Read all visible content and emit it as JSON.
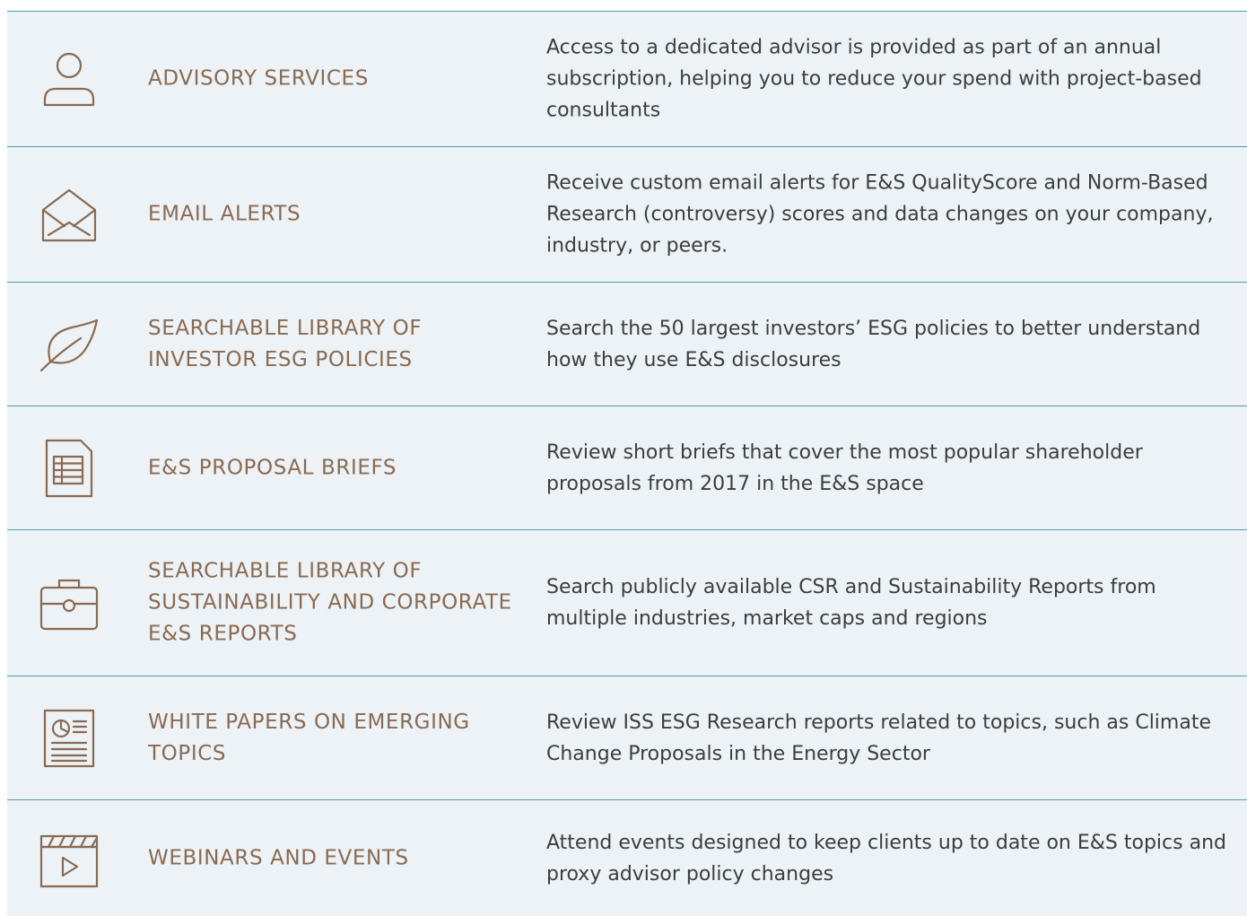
{
  "rows": [
    {
      "icon": "person-icon",
      "title": "ADVISORY SERVICES",
      "description": "Access to a dedicated advisor is provided as part of an annual subscription, helping you to reduce your spend with project-based consultants"
    },
    {
      "icon": "envelope-icon",
      "title": "EMAIL ALERTS",
      "description": "Receive custom email alerts for E&S QualityScore and Norm-Based Research (controversy) scores and data changes on your company, industry, or peers."
    },
    {
      "icon": "leaf-icon",
      "title": "SEARCHABLE LIBRARY OF INVESTOR ESG POLICIES",
      "description": "Search the 50 largest investors’ ESG policies to better understand how they use E&S disclosures"
    },
    {
      "icon": "spreadsheet-document-icon",
      "title": "E&S PROPOSAL BRIEFS",
      "description": "Review short briefs that cover the most popular shareholder proposals from 2017 in the E&S space"
    },
    {
      "icon": "briefcase-icon",
      "title": "SEARCHABLE LIBRARY OF SUSTAINABILITY AND CORPORATE E&S REPORTS",
      "description": "Search publicly available CSR and Sustainability Reports from multiple industries, market caps and regions"
    },
    {
      "icon": "report-chart-icon",
      "title": "WHITE PAPERS ON EMERGING TOPICS",
      "description": "Review ISS ESG Research reports related to topics, such as Climate Change Proposals in the Energy Sector"
    },
    {
      "icon": "video-clapper-icon",
      "title": "WEBINARS AND EVENTS",
      "description": "Attend events designed to keep clients up to date on E&S topics and proxy advisor policy changes"
    }
  ],
  "colors": {
    "row_background": "#ecf2f5",
    "divider": "#4c9bab",
    "title": "#8a6a52",
    "description": "#3d3d3d",
    "icon_stroke": "#8a6a52"
  }
}
